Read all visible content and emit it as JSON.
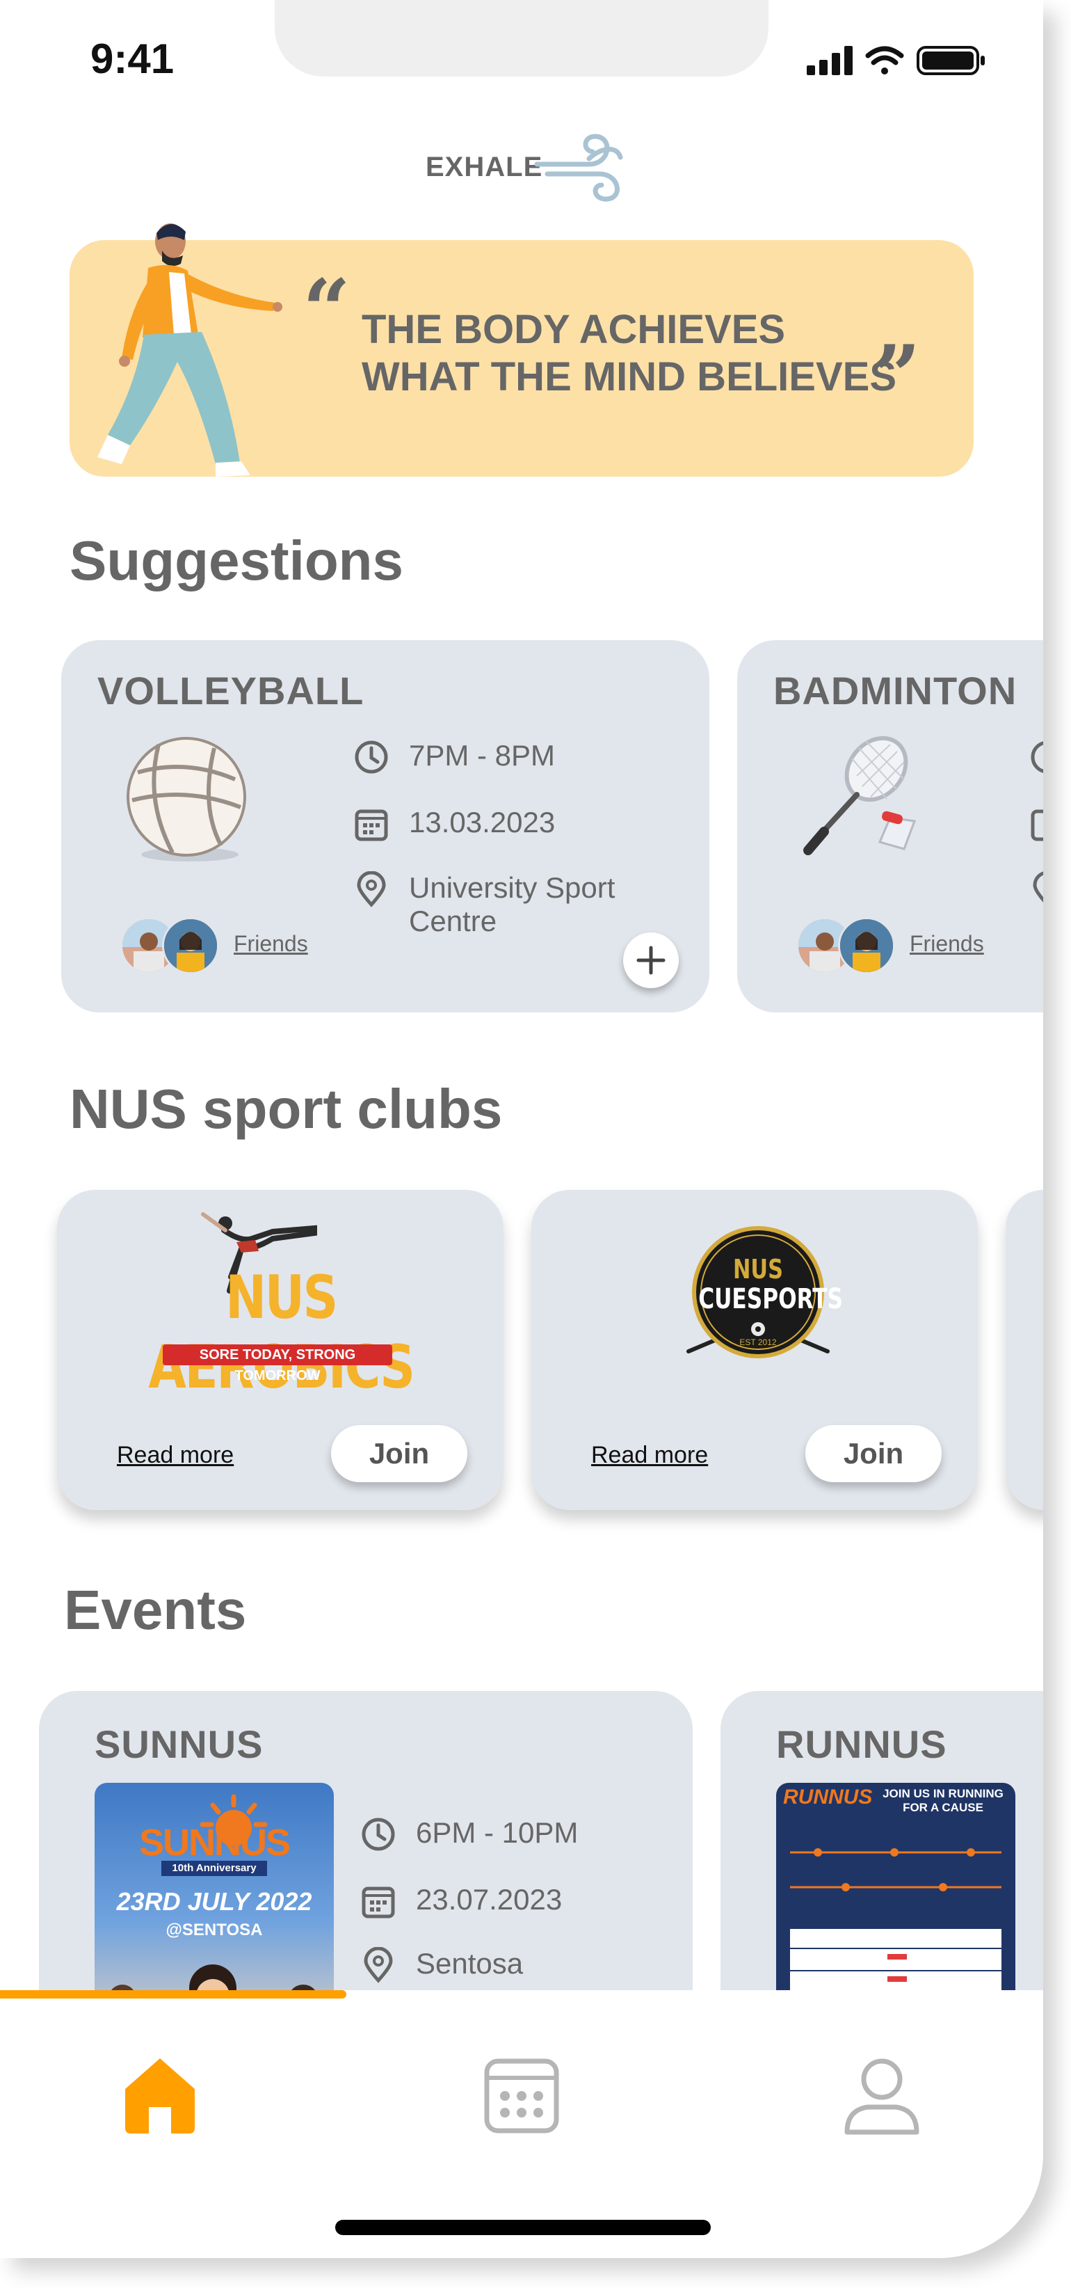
{
  "status_bar": {
    "time": "9:41"
  },
  "app": {
    "logo_text": "EXHALE"
  },
  "banner": {
    "quote_line1": "THE BODY ACHIEVES",
    "quote_line2": "WHAT THE MIND BELIEVES"
  },
  "suggestions": {
    "title": "Suggestions",
    "cards": [
      {
        "sport": "VOLLEYBALL",
        "time": "7PM - 8PM",
        "date": "13.03.2023",
        "location": "University Sport Centre",
        "location_line1": "University Sport",
        "location_line2": "Centre",
        "friends_label": "Friends"
      },
      {
        "sport": "BADMINTON",
        "friends_label": "Friends"
      }
    ]
  },
  "clubs": {
    "title": "NUS sport clubs",
    "cards": [
      {
        "name": "NUS AEROBICS",
        "tagline": "SORE TODAY, STRONG TOMORROW",
        "read_more": "Read more",
        "join_label": "Join"
      },
      {
        "name_line1": "NUS",
        "name_line2": "CUESPORTS",
        "est": "EST 2012",
        "read_more": "Read more",
        "join_label": "Join"
      }
    ]
  },
  "events": {
    "title": "Events",
    "cards": [
      {
        "name": "SUNNUS",
        "poster_title": "SUNNUS",
        "poster_sub": "10th Anniversary",
        "poster_date": "23RD JULY 2022",
        "poster_place": "@SENTOSA",
        "time": "6PM - 10PM",
        "date": "23.07.2023",
        "location": "Sentosa"
      },
      {
        "name": "RUNNUS",
        "poster_title": "RUNNUS",
        "poster_tagline": "JOIN US IN RUNNING FOR A CAUSE"
      }
    ]
  },
  "tabbar": {
    "active": "home",
    "items": [
      "home-icon",
      "calendar-icon",
      "profile-icon"
    ]
  },
  "colors": {
    "accent": "#ff9f00",
    "banner": "#fde0a6",
    "card": "#e1e6ec",
    "text": "#666666"
  }
}
